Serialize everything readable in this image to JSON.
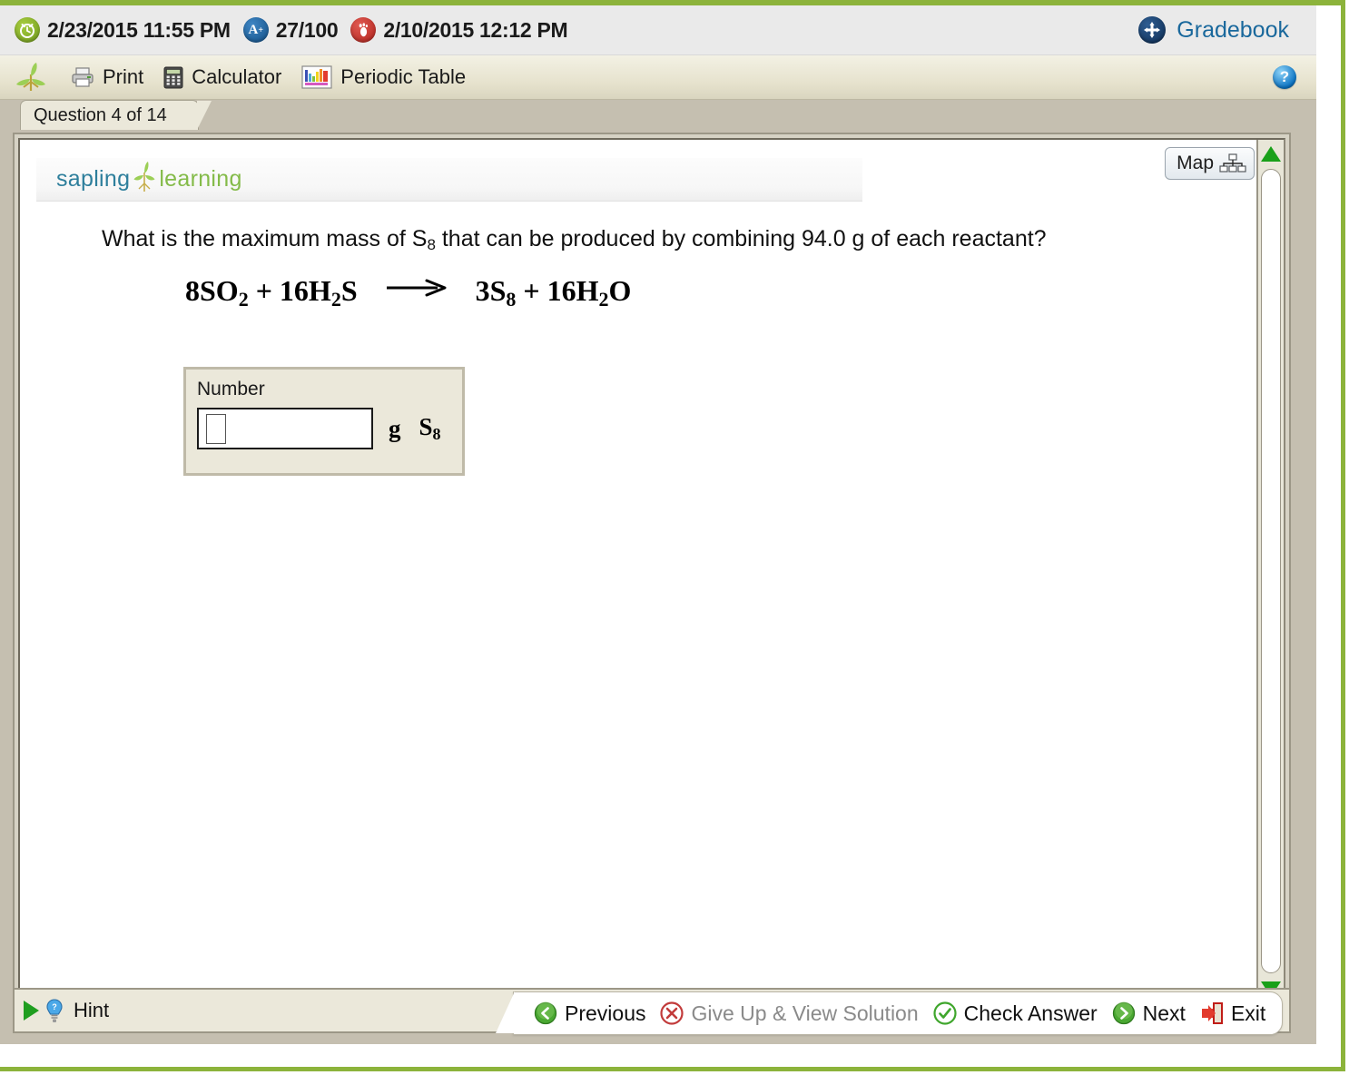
{
  "status": {
    "due_date": "2/23/2015 11:55 PM",
    "score": "27/100",
    "last_activity": "2/10/2015 12:12 PM",
    "icons": {
      "clock": "alarm-clock-icon",
      "grade": "a-plus-icon",
      "footprint": "footprint-icon"
    }
  },
  "gradebook": {
    "label": "Gradebook",
    "icon": "four-arrows-icon",
    "color": "#19689c"
  },
  "toolbar": {
    "leaf_icon": "sapling-leaf-icon",
    "items": [
      {
        "label": "Print",
        "icon": "printer-icon"
      },
      {
        "label": "Calculator",
        "icon": "calculator-icon"
      },
      {
        "label": "Periodic Table",
        "icon": "periodic-table-icon"
      }
    ],
    "help_label": "?"
  },
  "tab": {
    "label": "Question 4 of 14"
  },
  "map_button": {
    "label": "Map",
    "icon": "sitemap-icon"
  },
  "branding": {
    "word_one": "sapling",
    "word_two": "learning",
    "icon": "sapling-plant-icon"
  },
  "question": {
    "prompt_before": "What is the maximum mass of S",
    "prompt_sub": "8",
    "prompt_after": " that can be produced by combining 94.0 g of each reactant?",
    "equation": {
      "left": "8SO2 + 16H2S",
      "arrow": "⟶",
      "right": "3S8 + 16H2O",
      "left_parts": [
        {
          "text": "8SO",
          "sub": "2"
        },
        {
          "text": " + 16H",
          "sub": "2"
        },
        {
          "text": "S",
          "sub": ""
        }
      ],
      "right_parts": [
        {
          "text": "3S",
          "sub": "8"
        },
        {
          "text": " + 16H",
          "sub": "2"
        },
        {
          "text": "O",
          "sub": ""
        }
      ]
    }
  },
  "answer": {
    "label": "Number",
    "value": "",
    "placeholder": "",
    "unit": "g",
    "species": "S",
    "species_sub": "8"
  },
  "scrollbar": {
    "up_icon": "triangle-up-icon",
    "down_icon": "triangle-down-icon",
    "thumb_color": "#ffffff",
    "arrow_color": "#19a019"
  },
  "hint": {
    "label": "Hint",
    "expand_icon": "triangle-right-icon",
    "bulb_icon": "lightbulb-icon"
  },
  "navigation": [
    {
      "label": "Previous",
      "icon": "arrow-left-circle-icon",
      "state": "enabled",
      "color": "#3fa62c"
    },
    {
      "label": "Give Up & View Solution",
      "icon": "x-circle-icon",
      "state": "disabled",
      "color": "#c23b3b"
    },
    {
      "label": "Check Answer",
      "icon": "check-circle-icon",
      "state": "enabled",
      "color": "#3fa62c"
    },
    {
      "label": "Next",
      "icon": "arrow-right-circle-icon",
      "state": "enabled",
      "color": "#3fa62c"
    },
    {
      "label": "Exit",
      "icon": "exit-door-icon",
      "state": "enabled",
      "color": "#c8221c"
    }
  ],
  "theme": {
    "accent_green": "#8cb33b",
    "chrome_tan": "#c5bfb0",
    "panel_cream": "#ebe8da"
  }
}
